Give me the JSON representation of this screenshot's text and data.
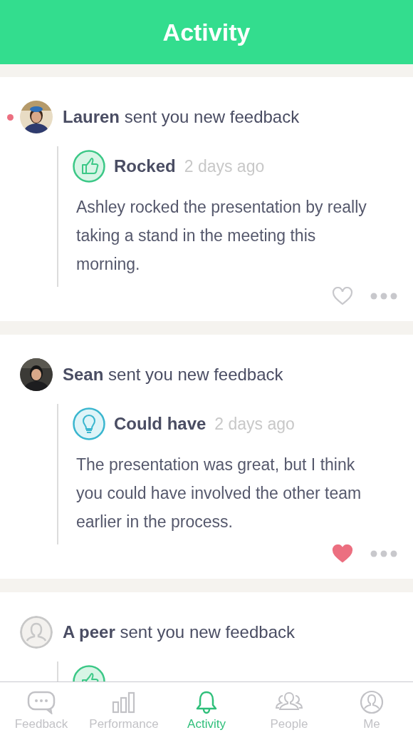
{
  "header": {
    "title": "Activity"
  },
  "feed": [
    {
      "author": "Lauren",
      "action": "sent you new feedback",
      "unread": true,
      "feedback": {
        "kind": "rocked",
        "title": "Rocked",
        "time": "2 days ago",
        "body": "Ashley rocked the presentation by really taking a stand in the meeting this morning."
      },
      "liked": false
    },
    {
      "author": "Sean",
      "action": "sent you new feedback",
      "unread": false,
      "feedback": {
        "kind": "could_have",
        "title": "Could have",
        "time": "2 days ago",
        "body": "The presentation was great, but I think you could have involved the other team earlier in the process."
      },
      "liked": true
    },
    {
      "author": "A peer",
      "action": "sent you new feedback",
      "unread": false,
      "avatar": {
        "kind": "anonymous"
      },
      "feedback": {
        "kind": "rocked"
      }
    }
  ],
  "tabs": [
    {
      "label": "Feedback",
      "kind": "feedback",
      "selected": false
    },
    {
      "label": "Performance",
      "kind": "performance",
      "selected": false
    },
    {
      "label": "Activity",
      "kind": "activity",
      "selected": true
    },
    {
      "label": "People",
      "kind": "people",
      "selected": false
    },
    {
      "label": "Me",
      "kind": "me",
      "selected": false
    }
  ]
}
